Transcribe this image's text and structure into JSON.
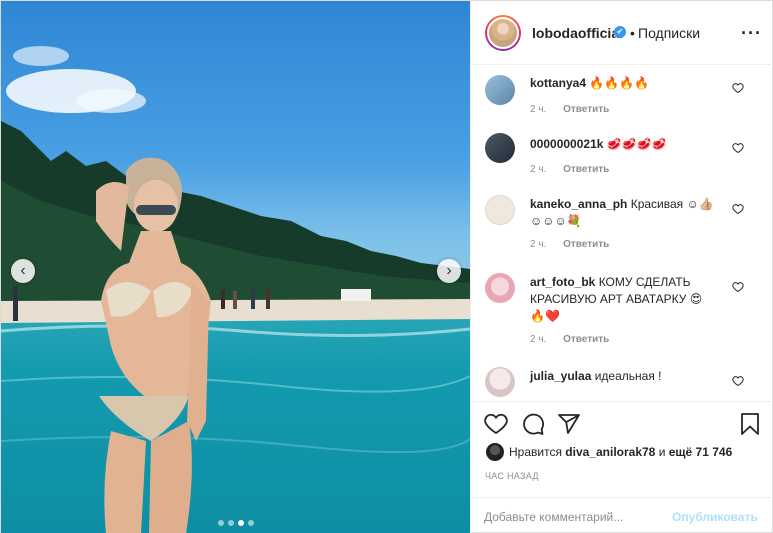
{
  "header": {
    "username": "lobodaofficial",
    "separator": "•",
    "follow_label": "Подписки",
    "more_icon": "more-horizontal-icon"
  },
  "carousel": {
    "prev_icon": "chevron-left-icon",
    "next_icon": "chevron-right-icon",
    "total_slides": 4,
    "active_slide": 3
  },
  "comments": [
    {
      "user": "kottanya4",
      "text": "🔥🔥🔥🔥",
      "time": "2 ч.",
      "reply": "Ответить",
      "avatar_color": "#7aa7c9"
    },
    {
      "user": "0000000021k",
      "text": "🥩🥩🥩🥩",
      "time": "2 ч.",
      "reply": "Ответить",
      "avatar_color": "#3b4a57"
    },
    {
      "user": "kaneko_anna_ph",
      "text": "Красивая ☺👍🏼 ☺☺☺💐",
      "time": "2 ч.",
      "reply": "Ответить",
      "avatar_color": "#e8e2d6"
    },
    {
      "user": "art_foto_bk",
      "text": "КОМУ СДЕЛАТЬ КРАСИВУЮ АРТ АВАТАРКУ 😍 🔥❤️",
      "time": "2 ч.",
      "reply": "Ответить",
      "avatar_color": "#f3c9cf"
    },
    {
      "user": "julia_yulaa",
      "text": "идеальная !",
      "time": "",
      "reply": "",
      "avatar_color": "#e9dfe1"
    }
  ],
  "actions": {
    "like_icon": "heart-icon",
    "comment_icon": "comment-icon",
    "share_icon": "share-icon",
    "save_icon": "bookmark-icon"
  },
  "likes": {
    "prefix": "Нравится",
    "user": "diva_anilorak78",
    "suffix": "и",
    "others": "ещё 71 746"
  },
  "time_ago": "ЧАС НАЗАД",
  "add_comment": {
    "placeholder": "Добавьте комментарий...",
    "publish_label": "Опубликовать"
  }
}
